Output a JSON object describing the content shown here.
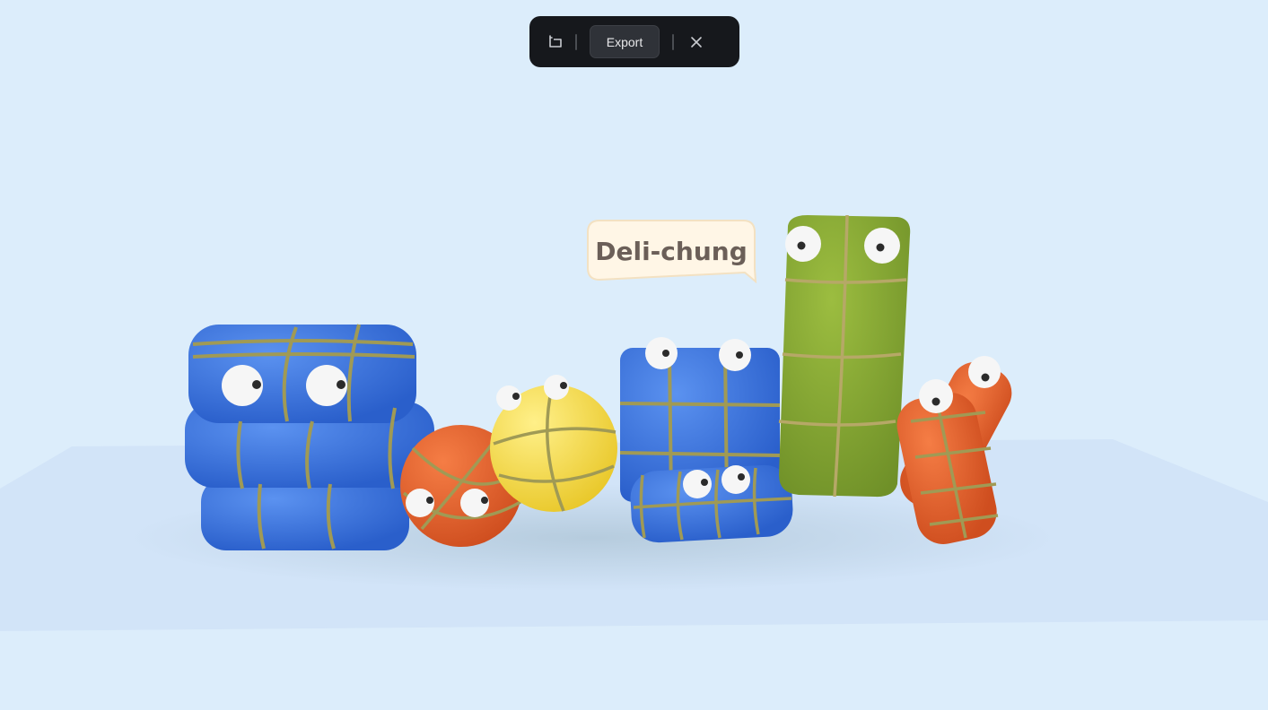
{
  "toolbar": {
    "undo_icon": "undo-icon",
    "export_label": "Export",
    "close_icon": "close-icon"
  },
  "scene": {
    "speech_bubble_text": "Deli-chung"
  },
  "colors": {
    "background": "#dcedfb",
    "toolbar": "#16181c",
    "blue": "#3a73dc",
    "orange": "#e8622e",
    "yellow": "#f5dc3c",
    "green": "#86a834"
  }
}
